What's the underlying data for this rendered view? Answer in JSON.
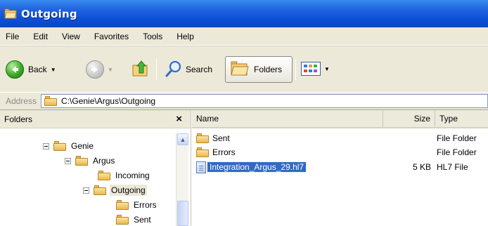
{
  "window": {
    "title": "Outgoing"
  },
  "menu": [
    "File",
    "Edit",
    "View",
    "Favorites",
    "Tools",
    "Help"
  ],
  "toolbar": {
    "back_label": "Back",
    "search_label": "Search",
    "folders_label": "Folders"
  },
  "address": {
    "label": "Address",
    "value": "C:\\Genie\\Argus\\Outgoing"
  },
  "folders_pane": {
    "title": "Folders",
    "close": "×",
    "tree": [
      {
        "label": "Genie",
        "expander": true,
        "open": false
      },
      {
        "label": "Argus",
        "expander": true,
        "open": false
      },
      {
        "label": "Incoming",
        "expander": false,
        "open": true
      },
      {
        "label": "Outgoing",
        "expander": true,
        "open": true,
        "selected": true
      },
      {
        "label": "Errors",
        "expander": false,
        "open": false
      },
      {
        "label": "Sent",
        "expander": false,
        "open": false
      }
    ]
  },
  "files_pane": {
    "columns": {
      "name": "Name",
      "size": "Size",
      "type": "Type"
    },
    "rows": [
      {
        "name": "Sent",
        "size": "",
        "type": "File Folder",
        "icon": "folder"
      },
      {
        "name": "Errors",
        "size": "",
        "type": "File Folder",
        "icon": "folder"
      },
      {
        "name": "Integration_Argus_29.hl7",
        "size": "5 KB",
        "type": "HL7 File",
        "icon": "document",
        "selected": true
      }
    ]
  },
  "colors": {
    "titlebar": "#0c4fd6",
    "chrome": "#ece9d8",
    "selection": "#316ac5"
  }
}
